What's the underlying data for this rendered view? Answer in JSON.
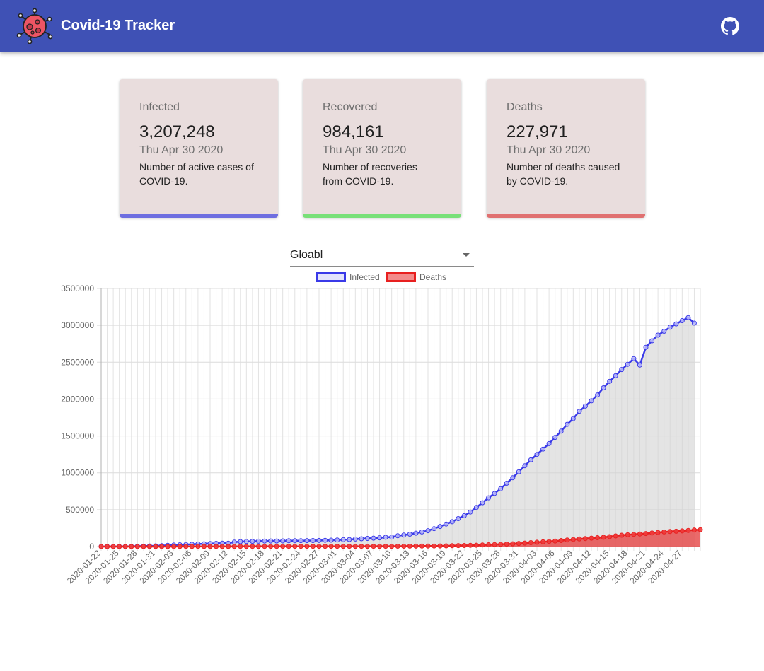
{
  "app": {
    "title": "Covid-19 Tracker",
    "logo_icon": "virus-icon",
    "repo_icon": "github-icon"
  },
  "cards": [
    {
      "title": "Infected",
      "value": "3,207,248",
      "date": "Thu Apr 30 2020",
      "description": "Number of active cases of COVID-19.",
      "accent": "#6e6ee0"
    },
    {
      "title": "Recovered",
      "value": "984,161",
      "date": "Thu Apr 30 2020",
      "description": "Number of recoveries from COVID-19.",
      "accent": "#78e078"
    },
    {
      "title": "Deaths",
      "value": "227,971",
      "date": "Thu Apr 30 2020",
      "description": "Number of deaths caused by COVID-19.",
      "accent": "#e07070"
    }
  ],
  "country_select": {
    "value": "Gloabl"
  },
  "chart_data": {
    "type": "line",
    "title": "",
    "xlabel": "",
    "ylabel": "",
    "ylim": [
      0,
      3500000
    ],
    "yticks": [
      0,
      500000,
      1000000,
      1500000,
      2000000,
      2500000,
      3000000,
      3500000
    ],
    "grid": true,
    "legend_placement": "top",
    "x_start": "2020-01-22",
    "x_end": "2020-04-30",
    "x_tick_labels": [
      "2020-01-22",
      "2020-01-25",
      "2020-01-28",
      "2020-01-31",
      "2020-02-03",
      "2020-02-06",
      "2020-02-09",
      "2020-02-12",
      "2020-02-15",
      "2020-02-18",
      "2020-02-21",
      "2020-02-24",
      "2020-02-27",
      "2020-03-01",
      "2020-03-04",
      "2020-03-07",
      "2020-03-10",
      "2020-03-13",
      "2020-03-16",
      "2020-03-19",
      "2020-03-22",
      "2020-03-25",
      "2020-03-28",
      "2020-03-31",
      "2020-04-03",
      "2020-04-06",
      "2020-04-09",
      "2020-04-12",
      "2020-04-15",
      "2020-04-18",
      "2020-04-21",
      "2020-04-24",
      "2020-04-27"
    ],
    "series": [
      {
        "name": "Infected",
        "color": "#3a3ae8",
        "fill": "rgba(210,210,210,0.6)",
        "values": [
          555,
          653,
          941,
          1434,
          2118,
          2927,
          5578,
          6166,
          8234,
          9927,
          12038,
          16787,
          19881,
          23892,
          27635,
          30794,
          34391,
          37120,
          40150,
          42762,
          44802,
          45221,
          60368,
          66885,
          69030,
          71224,
          73258,
          75136,
          75639,
          76197,
          76823,
          78579,
          78965,
          79570,
          80415,
          81397,
          82756,
          84124,
          86013,
          88371,
          92844,
          95124,
          101800,
          105836,
          109800,
          114000,
          118600,
          125800,
          128300,
          145300,
          156100,
          167400,
          181500,
          197100,
          214900,
          242700,
          272200,
          304500,
          336900,
          378300,
          418000,
          467600,
          529500,
          593200,
          660700,
          720100,
          784400,
          858400,
          932600,
          1013100,
          1095900,
          1175900,
          1249800,
          1321400,
          1396400,
          1480200,
          1565300,
          1657500,
          1735700,
          1834700,
          1904800,
          1976200,
          2056100,
          2152400,
          2240200,
          2317800,
          2401400,
          2472300,
          2549100,
          2461800,
          2701100,
          2790400,
          2866700,
          2920000,
          2975000,
          3020000,
          3064000,
          3105000,
          3030000
        ],
        "points_shown": true
      },
      {
        "name": "Deaths",
        "color": "#e82020",
        "fill": "rgba(230,80,80,0.85)",
        "values": [
          17,
          18,
          26,
          42,
          56,
          82,
          131,
          133,
          171,
          213,
          259,
          362,
          426,
          492,
          564,
          634,
          719,
          806,
          906,
          1013,
          1113,
          1118,
          1371,
          1523,
          1666,
          1770,
          1868,
          2007,
          2122,
          2247,
          2251,
          2458,
          2469,
          2629,
          2708,
          2770,
          2814,
          2872,
          2941,
          2996,
          3085,
          3160,
          3254,
          3348,
          3460,
          3558,
          3803,
          3996,
          4262,
          4615,
          4720,
          5404,
          5819,
          6440,
          7126,
          7905,
          8733,
          9867,
          11299,
          12973,
          14623,
          16497,
          18615,
          21181,
          23970,
          27198,
          30652,
          33925,
          37582,
          42107,
          46809,
          52983,
          58787,
          64606,
          69374,
          74565,
          81937,
          88338,
          95455,
          102525,
          108503,
          114091,
          119482,
          125984,
          134176,
          143800,
          153822,
          159510,
          165044,
          169985,
          176583,
          183027,
          190858,
          197159,
          202846,
          207000,
          211600,
          217800,
          224000,
          227971
        ],
        "points_shown": true
      }
    ]
  }
}
